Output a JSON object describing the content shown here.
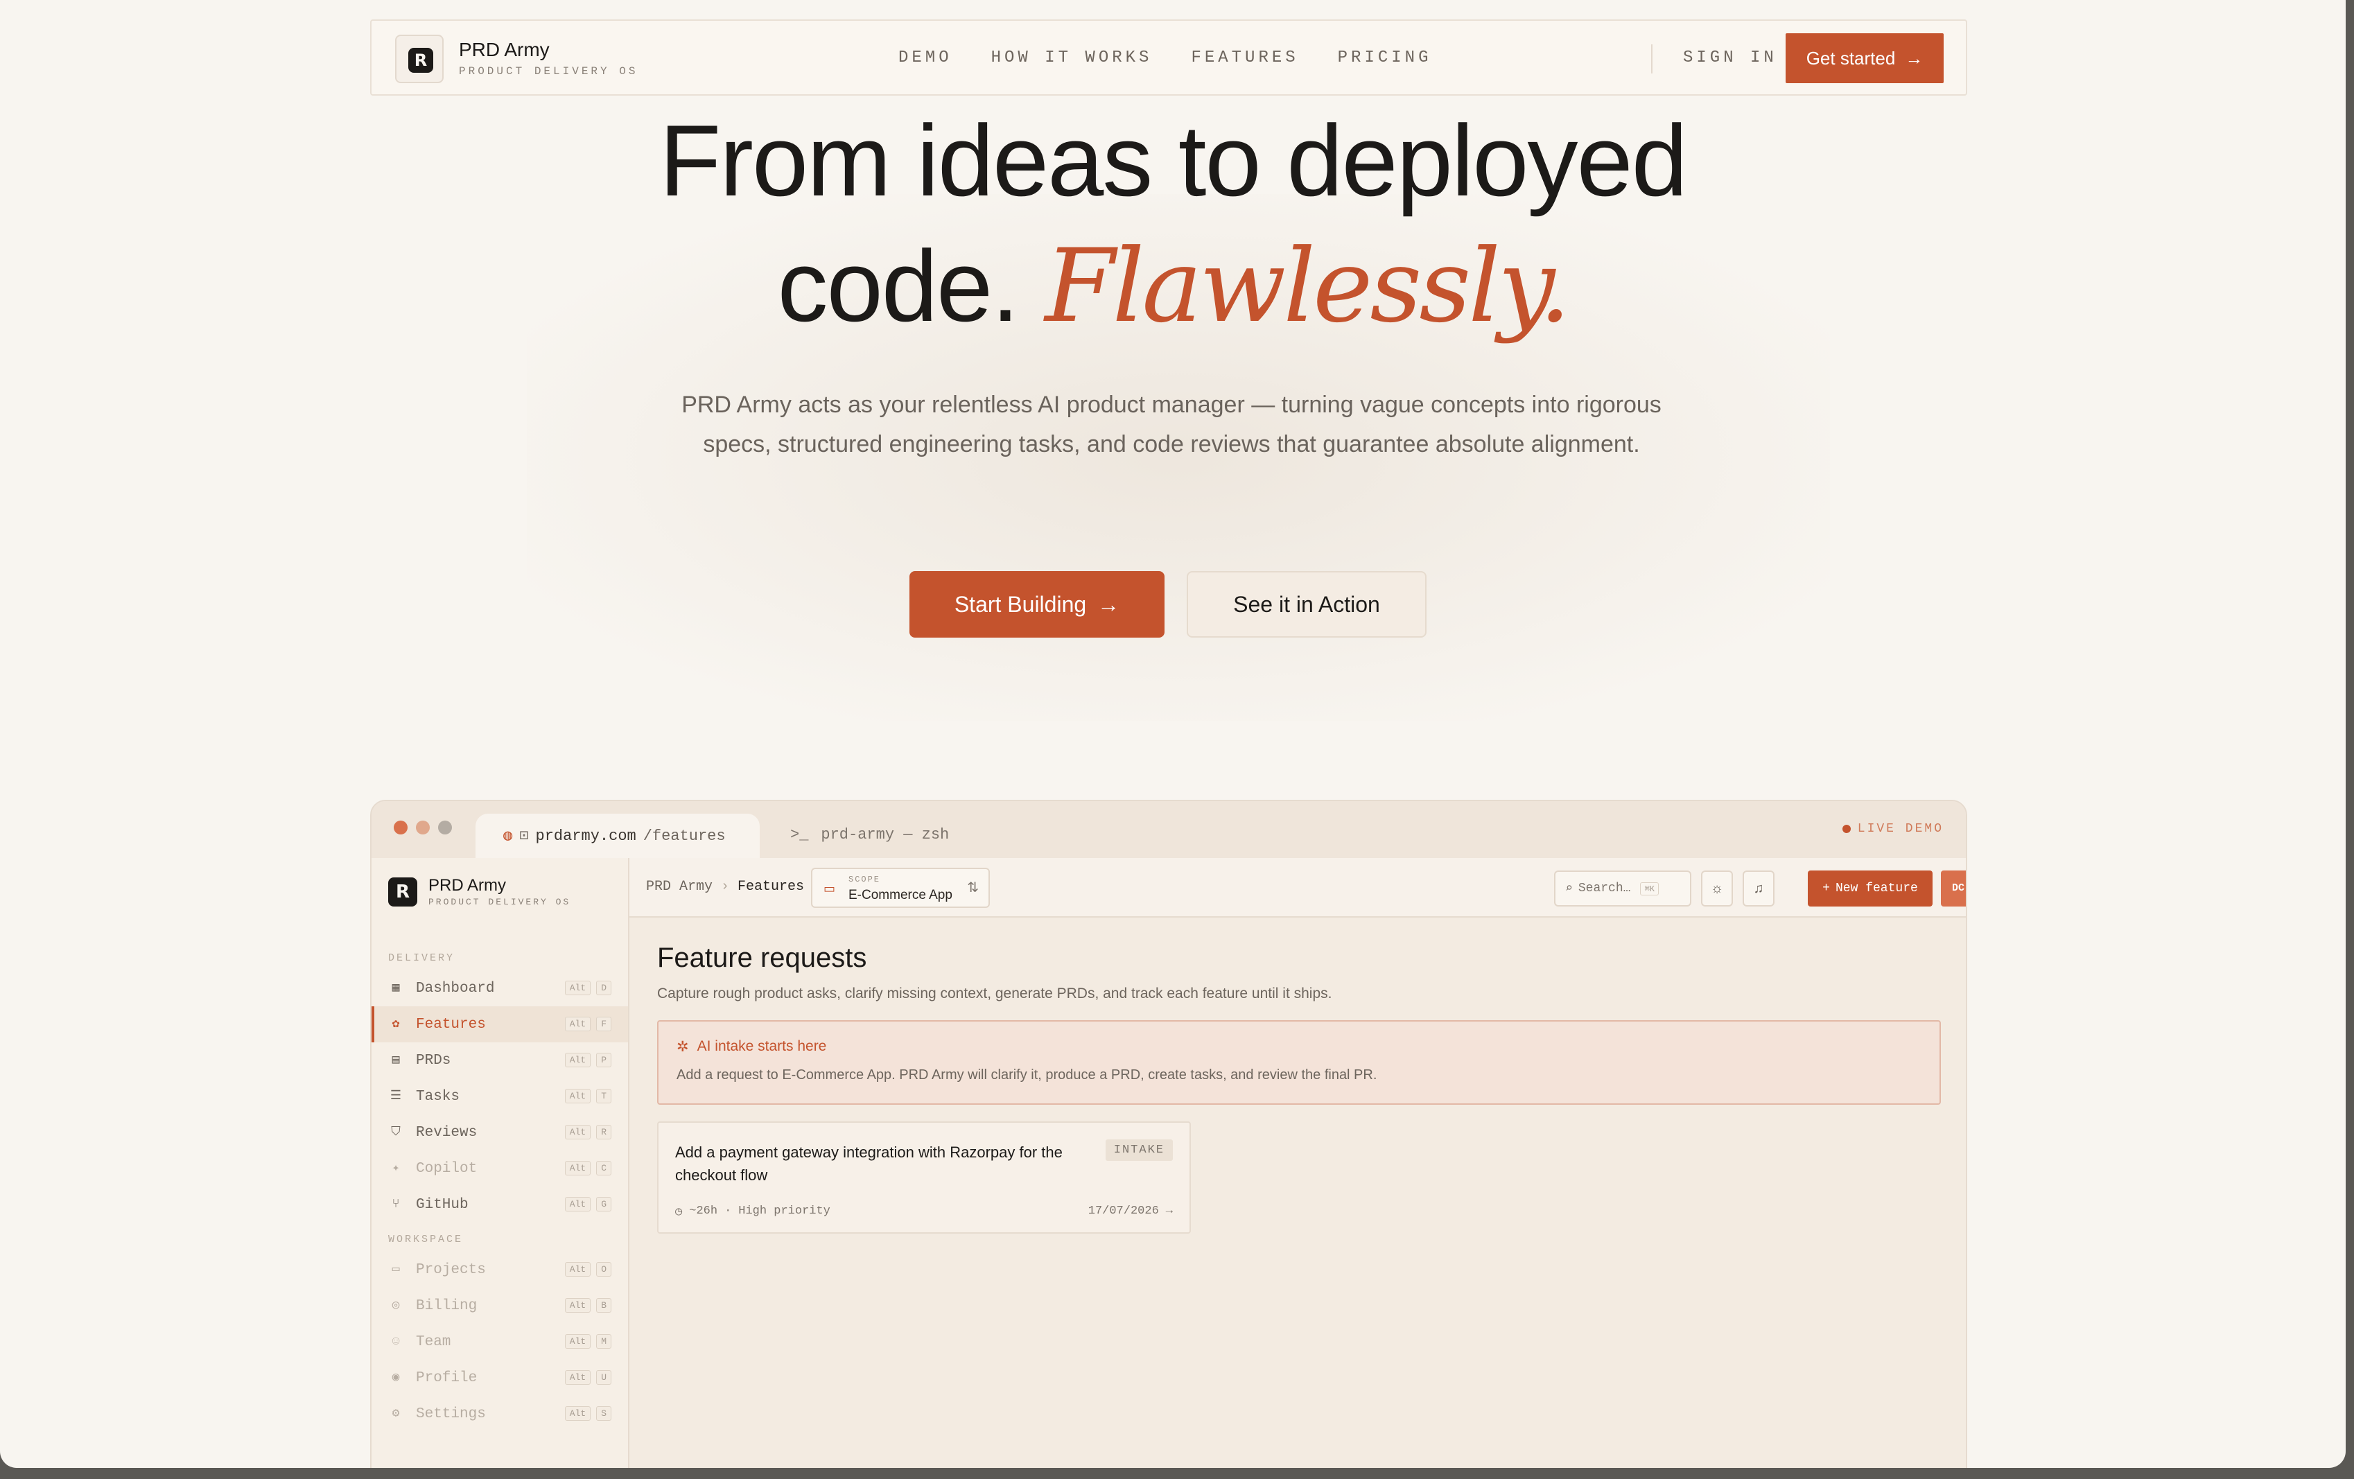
{
  "nav": {
    "brand_mark": "R",
    "brand_name": "PRD Army",
    "brand_sub": "PRODUCT DELIVERY OS",
    "links": [
      "DEMO",
      "HOW IT WORKS",
      "FEATURES",
      "PRICING"
    ],
    "sign_in": "SIGN IN",
    "cta": "Get started",
    "cta_icon": "arrow-right-icon"
  },
  "hero": {
    "line1": "From ideas to deployed",
    "line2_plain": "code.",
    "line2_accent": "Flawlessly.",
    "lede": "PRD Army acts as your relentless AI product manager — turning vague concepts into rigorous specs, structured engineering tasks, and code reviews that guarantee absolute alignment.",
    "primary_button": "Start Building",
    "secondary_button": "See it in Action"
  },
  "demo": {
    "tab_domain": "prdarmy.com",
    "tab_path": "/features",
    "terminal_tab": "prd-army — zsh",
    "live_badge": "LIVE DEMO",
    "sidebar": {
      "brand_name": "PRD Army",
      "brand_sub": "PRODUCT DELIVERY OS",
      "section_delivery": "DELIVERY",
      "section_workspace": "WORKSPACE",
      "items": [
        {
          "label": "Dashboard",
          "key": "D",
          "icon": "grid-icon"
        },
        {
          "label": "Features",
          "key": "F",
          "icon": "shapes-icon"
        },
        {
          "label": "PRDs",
          "key": "P",
          "icon": "scroll-icon"
        },
        {
          "label": "Tasks",
          "key": "T",
          "icon": "list-check-icon"
        },
        {
          "label": "Reviews",
          "key": "R",
          "icon": "shield-icon"
        },
        {
          "label": "Copilot",
          "key": "C",
          "icon": "sparkle-icon"
        },
        {
          "label": "GitHub",
          "key": "G",
          "icon": "branch-icon"
        },
        {
          "label": "Projects",
          "key": "O",
          "icon": "folder-icon"
        },
        {
          "label": "Billing",
          "key": "B",
          "icon": "coin-icon"
        },
        {
          "label": "Team",
          "key": "M",
          "icon": "users-icon"
        },
        {
          "label": "Profile",
          "key": "U",
          "icon": "user-circle-icon"
        },
        {
          "label": "Settings",
          "key": "S",
          "icon": "gear-icon"
        }
      ],
      "alt_label": "Alt"
    },
    "toolbar": {
      "crumb_root": "PRD Army",
      "crumb_sep": "›",
      "crumb_current": "Features",
      "scope_label": "SCOPE",
      "scope_value": "E-Commerce App",
      "search_placeholder": "Search…",
      "search_shortcut": "⌘K",
      "new_feature": "New feature",
      "avatar": "DC"
    },
    "page": {
      "title": "Feature requests",
      "description": "Capture rough product asks, clarify missing context, generate PRDs, and track each feature until it ships.",
      "intake_title": "AI intake starts here",
      "intake_desc": "Add a request to E-Commerce App. PRD Army will clarify it, produce a PRD, create tasks, and review the final PR.",
      "card": {
        "title": "Add a payment gateway integration with Razorpay for the checkout flow",
        "badge": "INTAKE",
        "estimate": "~26h",
        "priority": "High priority",
        "date": "17/07/2026"
      }
    }
  },
  "colors": {
    "accent": "#c4532d",
    "background": "#f8f5f0",
    "text": "#1c1a18"
  }
}
